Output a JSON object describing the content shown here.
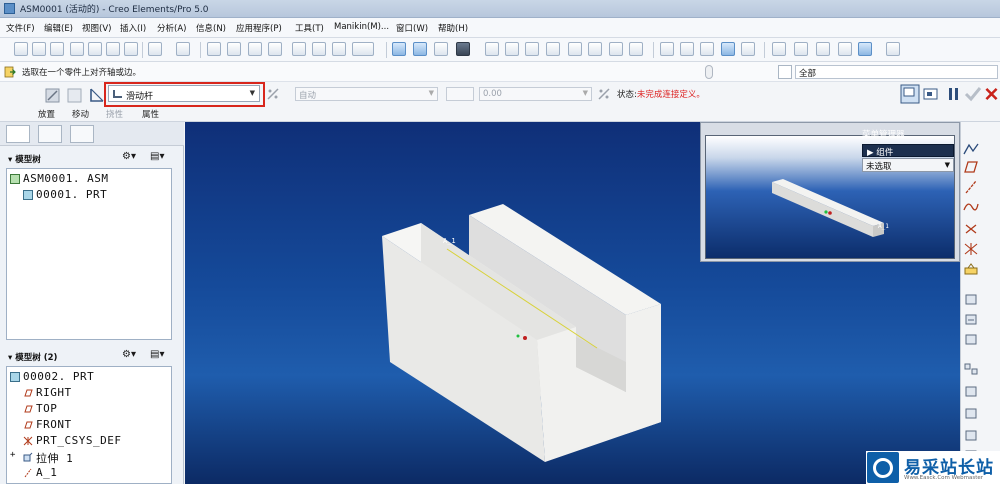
{
  "window": {
    "title": "ASM0001 (活动的) - Creo Elements/Pro 5.0"
  },
  "menubar": {
    "items": [
      "文件(F)",
      "编辑(E)",
      "视图(V)",
      "插入(I)",
      "分析(A)",
      "信息(N)",
      "应用程序(P)",
      "工具(T)",
      "Manikin(M)...",
      "窗口(W)",
      "帮助(H)"
    ]
  },
  "selection": {
    "hint": "选取在一个零件上对齐轴或边。",
    "filter_value": "全部"
  },
  "dashboard": {
    "connection_type": "滑动杆",
    "constraint_value": "自动",
    "offset_value": "0.00",
    "status_label": "状态:",
    "status_value": "未完成连接定义。",
    "tabs": [
      "放置",
      "移动",
      "挠性",
      "属性"
    ]
  },
  "model_tree_1": {
    "header": "模型树",
    "items": [
      {
        "label": "ASM0001. ASM",
        "icon": "assembly-icon"
      },
      {
        "label": "00001. PRT",
        "icon": "part-icon"
      }
    ]
  },
  "model_tree_2": {
    "header": "模型树 (2)",
    "items": [
      {
        "label": "00002. PRT",
        "icon": "part-icon"
      },
      {
        "label": "RIGHT",
        "icon": "datum-plane-icon"
      },
      {
        "label": "TOP",
        "icon": "datum-plane-icon"
      },
      {
        "label": "FRONT",
        "icon": "datum-plane-icon"
      },
      {
        "label": "PRT_CSYS_DEF",
        "icon": "csys-icon"
      },
      {
        "label": "拉伸 1",
        "icon": "extrude-icon"
      },
      {
        "label": "A_1",
        "icon": "axis-icon"
      }
    ]
  },
  "viewport": {
    "axis_label_main": "A_1",
    "axis_label_sub": "A_1",
    "background_top": "#0f2f78",
    "background_bottom": "#0c2a64"
  },
  "menu_manager": {
    "title": "菜单管理器",
    "item_expanded": "组件",
    "item_selected": "未选取"
  },
  "watermark": {
    "name": "易采站长站",
    "url": "Www.Easck.Com  Webmaster"
  },
  "colors": {
    "highlight_red": "#d8261c",
    "status_red": "#dd2222",
    "brand_blue": "#0e5fa8"
  }
}
